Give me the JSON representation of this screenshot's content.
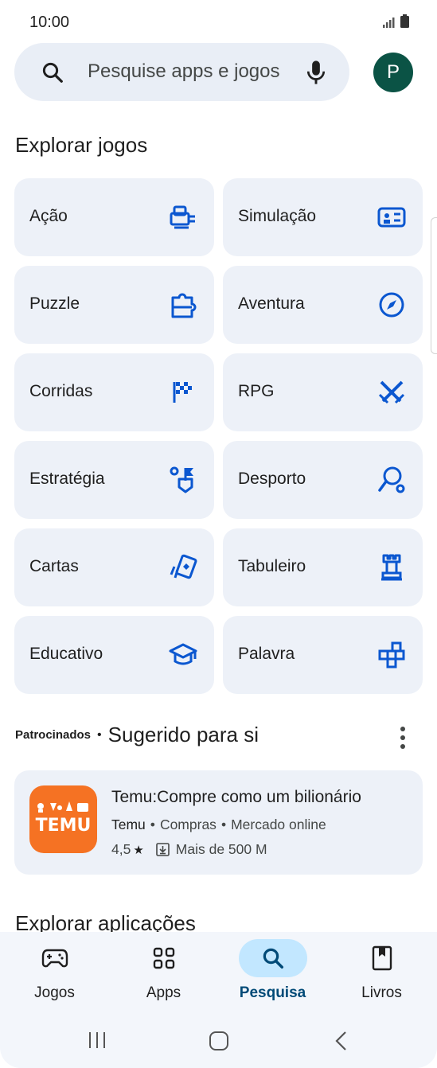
{
  "status_bar": {
    "time": "10:00"
  },
  "search": {
    "placeholder": "Pesquise apps e jogos",
    "avatar_letter": "P"
  },
  "explore_games": {
    "title": "Explorar jogos",
    "categories": [
      {
        "label": "Ação",
        "icon": "action-game-icon"
      },
      {
        "label": "Simulação",
        "icon": "simulation-icon"
      },
      {
        "label": "Puzzle",
        "icon": "puzzle-icon"
      },
      {
        "label": "Aventura",
        "icon": "compass-icon"
      },
      {
        "label": "Corridas",
        "icon": "checkered-flag-icon"
      },
      {
        "label": "RPG",
        "icon": "crossed-swords-icon"
      },
      {
        "label": "Estratégia",
        "icon": "strategy-icon"
      },
      {
        "label": "Desporto",
        "icon": "sports-racket-icon"
      },
      {
        "label": "Cartas",
        "icon": "cards-icon"
      },
      {
        "label": "Tabuleiro",
        "icon": "chess-rook-icon"
      },
      {
        "label": "Educativo",
        "icon": "graduation-cap-icon"
      },
      {
        "label": "Palavra",
        "icon": "word-blocks-icon"
      }
    ]
  },
  "suggested": {
    "sponsored_label": "Patrocinados",
    "separator": "•",
    "title": "Sugerido para si",
    "app": {
      "name": "Temu:Compre como um bilionário",
      "developer": "Temu",
      "category": "Compras",
      "subcategory": "Mercado online",
      "rating": "4,5",
      "rating_star": "★",
      "downloads": "Mais de 500 M",
      "icon_text": "TEMU",
      "icon_color": "#f57223"
    }
  },
  "explore_apps": {
    "title": "Explorar aplicações"
  },
  "bottom_nav": {
    "items": [
      {
        "label": "Jogos",
        "icon": "gamepad-icon"
      },
      {
        "label": "Apps",
        "icon": "apps-grid-icon"
      },
      {
        "label": "Pesquisa",
        "icon": "search-icon",
        "active": true
      },
      {
        "label": "Livros",
        "icon": "book-icon"
      }
    ]
  },
  "colors": {
    "accent": "#0b57d0",
    "tile_bg": "#edf1f8",
    "active_pill": "#c2e7ff",
    "avatar_bg": "#0b5345"
  }
}
